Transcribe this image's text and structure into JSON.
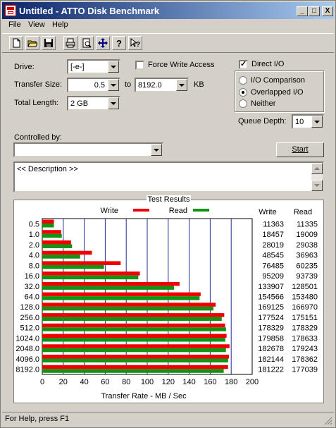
{
  "window": {
    "title": "Untitled - ATTO Disk Benchmark",
    "min_glyph": "_",
    "max_glyph": "□",
    "close_glyph": "X"
  },
  "menu": {
    "file": "File",
    "view": "View",
    "help": "Help"
  },
  "toolbar": {
    "icons": [
      "new-icon",
      "open-icon",
      "save-icon",
      "print-icon",
      "print-preview-icon",
      "move-icon",
      "help-icon",
      "context-help-icon"
    ]
  },
  "form": {
    "drive_label": "Drive:",
    "drive_value": "[-e-]",
    "force_write_label": "Force Write Access",
    "force_write_checked": false,
    "direct_io_label": "Direct I/O",
    "direct_io_checked": true,
    "transfer_size_label": "Transfer Size:",
    "transfer_from": "0.5",
    "transfer_to_label": "to",
    "transfer_to": "8192.0",
    "transfer_unit": "KB",
    "total_length_label": "Total Length:",
    "total_length_value": "2 GB",
    "io_comparison_label": "I/O Comparison",
    "overlapped_io_label": "Overlapped I/O",
    "neither_label": "Neither",
    "io_mode_selected": "Overlapped I/O",
    "queue_depth_label": "Queue Depth:",
    "queue_depth_value": "10",
    "controlled_by_label": "Controlled by:",
    "controlled_by_value": "",
    "start_label": "Start",
    "description_text": "<< Description >>"
  },
  "results": {
    "title": "Test Results",
    "write_legend": "Write",
    "read_legend": "Read",
    "write_col": "Write",
    "read_col": "Read",
    "write_color": "#ee0000",
    "read_color": "#149214"
  },
  "chart_data": {
    "type": "bar",
    "orientation": "horizontal",
    "title": "Test Results",
    "xlabel": "Transfer Rate - MB / Sec",
    "xlim": [
      0,
      200
    ],
    "xticks": [
      0,
      20,
      40,
      60,
      80,
      100,
      120,
      140,
      160,
      180,
      200
    ],
    "grid": true,
    "legend_position": "top",
    "categories": [
      "0.5",
      "1.0",
      "2.0",
      "4.0",
      "8.0",
      "16.0",
      "32.0",
      "64.0",
      "128.0",
      "256.0",
      "512.0",
      "1024.0",
      "2048.0",
      "4096.0",
      "8192.0"
    ],
    "series": [
      {
        "name": "Write",
        "color": "#ee0000",
        "values": [
          11.1,
          18.0,
          27.4,
          47.3,
          74.7,
          93.0,
          130.8,
          150.9,
          165.2,
          173.4,
          174.2,
          175.6,
          178.4,
          177.9,
          177.0
        ]
      },
      {
        "name": "Read",
        "color": "#149214",
        "values": [
          11.1,
          18.6,
          28.4,
          36.1,
          58.8,
          91.5,
          125.5,
          149.9,
          163.1,
          171.0,
          175.1,
          174.4,
          175.0,
          177.1,
          172.9
        ]
      }
    ],
    "write_kb_s": [
      "11363",
      "18457",
      "28019",
      "48545",
      "76485",
      "95209",
      "133907",
      "154566",
      "169125",
      "177524",
      "178329",
      "179858",
      "182678",
      "182144",
      "181222"
    ],
    "read_kb_s": [
      "11335",
      "19009",
      "29038",
      "36963",
      "60235",
      "93739",
      "128501",
      "153480",
      "166970",
      "175151",
      "178329",
      "178633",
      "179243",
      "178362",
      "177039"
    ]
  },
  "status": {
    "text": "For Help, press F1"
  }
}
